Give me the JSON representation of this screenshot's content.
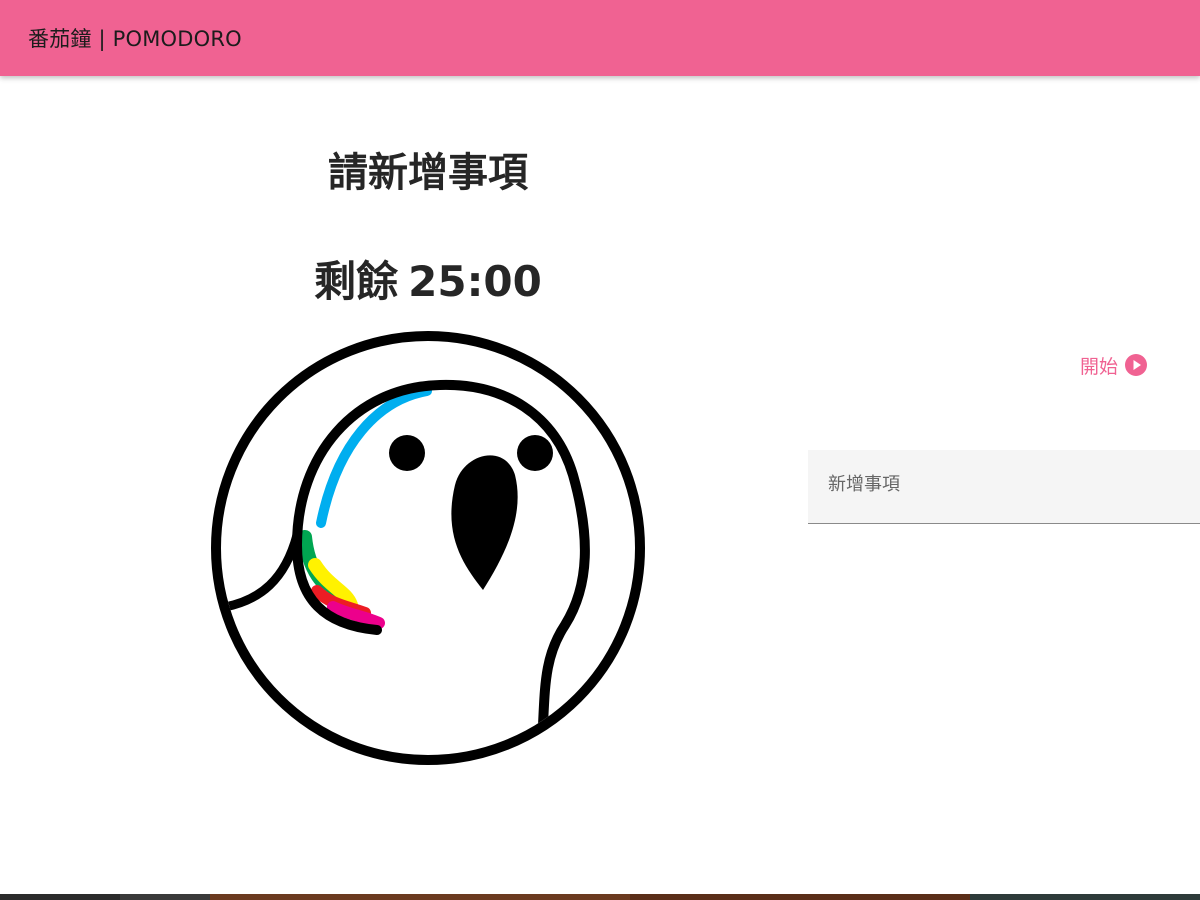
{
  "header": {
    "title": "番茄鐘 | POMODORO",
    "background": "#f06292"
  },
  "main": {
    "task_title": "請新增事項",
    "timer": {
      "label": "剩餘",
      "time": "25:00"
    },
    "image": {
      "name": "parrot-logo",
      "colors": [
        "#00aeef",
        "#00a651",
        "#fff200",
        "#ed1c24",
        "#ec008c",
        "#000000"
      ]
    }
  },
  "controls": {
    "start_label": "開始",
    "start_icon": "play-circle-icon",
    "accent": "#f06292"
  },
  "task_input": {
    "placeholder": "新增事項",
    "value": ""
  }
}
